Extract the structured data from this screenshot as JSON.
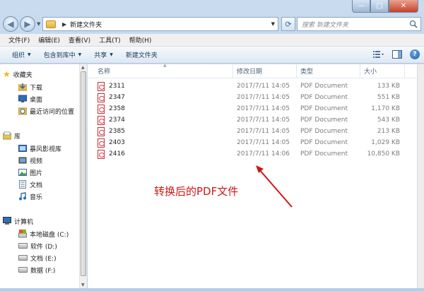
{
  "window": {
    "controls": {
      "minimize": "—",
      "maximize": "□",
      "close": "✕"
    }
  },
  "address": {
    "path": "新建文件夹",
    "search_placeholder": "搜索 新建文件夹"
  },
  "menubar": [
    "文件(F)",
    "编辑(E)",
    "查看(V)",
    "工具(T)",
    "帮助(H)"
  ],
  "toolbar": {
    "organize": "组织",
    "include_library": "包含到库中",
    "share": "共享",
    "new_folder": "新建文件夹",
    "help": "?"
  },
  "sidebar": {
    "favorites": {
      "label": "收藏夹",
      "items": [
        "下载",
        "桌面",
        "最近访问的位置"
      ]
    },
    "libraries": {
      "label": "库",
      "items": [
        "暴风影视库",
        "视频",
        "图片",
        "文档",
        "音乐"
      ]
    },
    "computer": {
      "label": "计算机",
      "items": [
        "本地磁盘 (C:)",
        "软件 (D:)",
        "文档 (E:)",
        "数据 (F:)"
      ]
    }
  },
  "columns": {
    "name": "名称",
    "date": "修改日期",
    "type": "类型",
    "size": "大小"
  },
  "files": [
    {
      "name": "2311",
      "date": "2017/7/11 14:05",
      "type": "PDF Document",
      "size": "133 KB"
    },
    {
      "name": "2347",
      "date": "2017/7/11 14:05",
      "type": "PDF Document",
      "size": "551 KB"
    },
    {
      "name": "2358",
      "date": "2017/7/11 14:05",
      "type": "PDF Document",
      "size": "1,170 KB"
    },
    {
      "name": "2374",
      "date": "2017/7/11 14:05",
      "type": "PDF Document",
      "size": "543 KB"
    },
    {
      "name": "2385",
      "date": "2017/7/11 14:05",
      "type": "PDF Document",
      "size": "213 KB"
    },
    {
      "name": "2403",
      "date": "2017/7/11 14:05",
      "type": "PDF Document",
      "size": "1,029 KB"
    },
    {
      "name": "2416",
      "date": "2017/7/11 14:06",
      "type": "PDF Document",
      "size": "10,850 KB"
    }
  ],
  "annotation": "转换后的PDF文件",
  "colors": {
    "annotation": "#d11515",
    "accent": "#2d6ab0"
  }
}
